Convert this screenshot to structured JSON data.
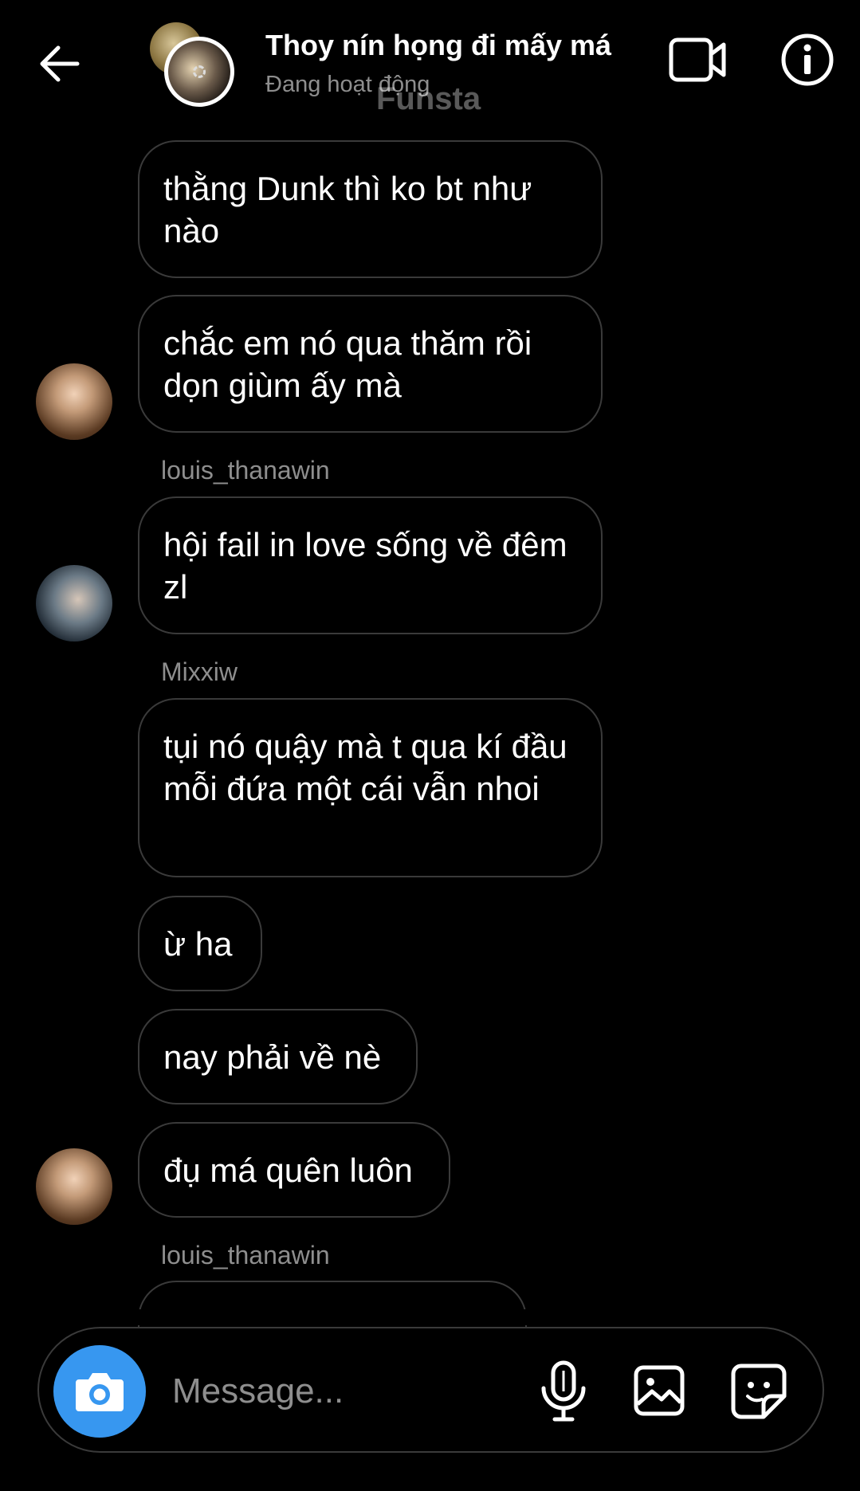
{
  "header": {
    "title": "Thoy nín họng đi mấy má",
    "status": "Đang hoạt động",
    "watermark": "Funsta"
  },
  "messages": [
    {
      "text": "thằng Dunk thì ko bt như nào"
    },
    {
      "text": "chắc em nó qua thăm rồi dọn giùm ấy mà"
    },
    {
      "sender": "louis_thanawin",
      "text": "hội fail in love sống về đêm zl"
    },
    {
      "sender": "Mixxiw",
      "text": "tụi nó quậy mà t qua kí đầu mỗi đứa một cái vẫn nhoi"
    },
    {
      "text": "ừ ha"
    },
    {
      "text": "nay phải về nè"
    },
    {
      "text": "đụ má quên luôn"
    },
    {
      "sender": "louis_thanawin"
    }
  ],
  "composer": {
    "placeholder": "Message..."
  },
  "colors": {
    "background": "#000000",
    "bubble_border": "#3a3a3a",
    "camera_button": "#3797f0",
    "secondary_text": "#8e8e8e"
  },
  "icons": {
    "back": "back-arrow-icon",
    "video": "video-camera-icon",
    "info": "info-icon",
    "camera": "camera-icon",
    "mic": "microphone-icon",
    "gallery": "gallery-icon",
    "sticker": "sticker-icon"
  }
}
